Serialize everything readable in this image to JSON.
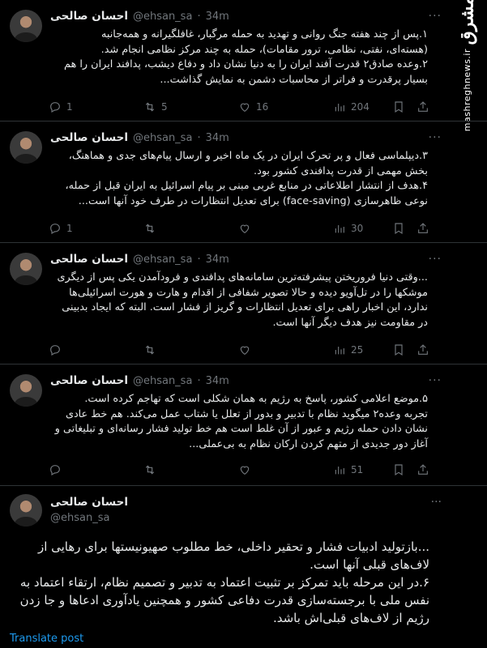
{
  "watermark": {
    "logo": "مشرق",
    "url": "mashreghnews.ir"
  },
  "tweets": [
    {
      "name": "احسان صالحی",
      "handle": "@ehsan_sa",
      "dot": "·",
      "time": "34m",
      "lines": [
        "۱.پس از چند هفته جنگ روانی و تهدید به حمله مرگبار، غافلگیرانه و همه‌جانبه",
        "(هسته‌ای، نفتی، نظامی، ترور مقامات)، حمله به چند مرکز نظامی انجام شد.",
        "۲.وعده صادق۲ قدرت آفند ایران را به دنیا نشان داد و دفاع دیشب، پدافند ایران را هم",
        "بسیار پرقدرت و فراتر از محاسبات دشمن به نمایش گذاشت..."
      ],
      "replies": "1",
      "reposts": "5",
      "likes": "16",
      "views": "204"
    },
    {
      "name": "احسان صالحی",
      "handle": "@ehsan_sa",
      "dot": "·",
      "time": "34m",
      "lines": [
        "۳.دیپلماسی فعال و پر تحرک ایران در یک ماه اخیر و ارسال پیام‌های جدی و هماهنگ،",
        "بخش مهمی از قدرت پدافندی کشور بود.",
        "۴.هدف از انتشار اطلاعاتی در منابع غربی مبنی بر پیام اسرائیل به ایران قبل از حمله،",
        "نوعی ظاهرسازی (face-saving) برای تعدیل انتظارات در طرف خود آنها است..."
      ],
      "replies": "1",
      "reposts": "",
      "likes": "",
      "views": "30"
    },
    {
      "name": "احسان صالحی",
      "handle": "@ehsan_sa",
      "dot": "·",
      "time": "34m",
      "lines": [
        "...وقتی دنیا فروریختن پیشرفته‌ترین سامانه‌های پدافندی و فرودآمدن یکی پس از دیگری",
        "موشکها را در تل‌آویو دیده و حالا تصویر شفافی از اقدام و هارت و هورت اسرائیلی‌ها",
        "ندارد، این اخبار راهی برای تعدیل انتظارات و گریز از فشار است. البته که ایجاد بدبینی",
        "در مقاومت نیز هدف دیگر آنها است."
      ],
      "replies": "",
      "reposts": "",
      "likes": "",
      "views": "25"
    },
    {
      "name": "احسان صالحی",
      "handle": "@ehsan_sa",
      "dot": "·",
      "time": "34m",
      "lines": [
        "۵.موضع اعلامی کشور، پاسخ به رژیم به همان شکلی است که تهاجم کرده است.",
        "تجربه وعده۲ میگوید نظام با تدبیر و بدور از تعلل یا شتاب عمل می‌کند. هم خط عادی",
        "نشان دادن حمله رژیم و عبور از آن غلط است هم خط تولید فشار رسانه‌ای و تبلیغاتی و",
        "آغاز دور جدیدی از متهم کردن ارکان نظام به بی‌عملی..."
      ],
      "replies": "",
      "reposts": "",
      "likes": "",
      "views": "51"
    }
  ],
  "main": {
    "name": "احسان صالحی",
    "handle": "@ehsan_sa",
    "lines": [
      "...بازتولید ادبیات فشار و تحقیر داخلی، خط مطلوب صهیونیستها برای رهایی از",
      "لاف‌های قبلی آنها است.",
      "۶.در این مرحله باید تمرکز بر تثبیت اعتماد به تدبیر و تصمیم نظام، ارتقاء اعتماد به",
      "نفس ملی با برجسته‌سازی قدرت دفاعی کشور و همچنین یادآوری ادعاها و جا زدن",
      "رژیم از لاف‌های قبلی‌اش باشد."
    ],
    "translate": "Translate post"
  }
}
